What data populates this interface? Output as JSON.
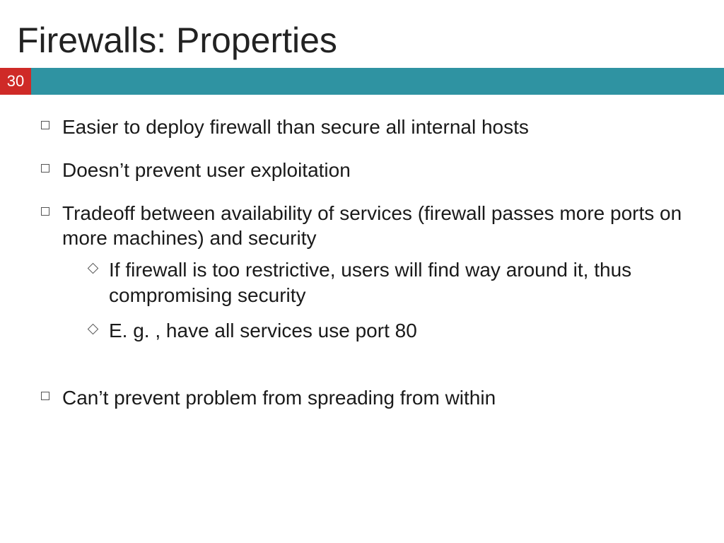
{
  "title": "Firewalls: Properties",
  "page_number": "30",
  "bullets": {
    "b1": "Easier to deploy firewall than secure all internal hosts",
    "b2": "Doesn’t prevent user exploitation",
    "b3": "Tradeoff between availability of services (firewall passes more ports on more machines) and security",
    "b3_sub1": "If firewall is too restrictive, users will find way around it, thus compromising security",
    "b3_sub2": "E. g. , have all services use port 80",
    "b4": "Can’t prevent problem from spreading from within"
  }
}
